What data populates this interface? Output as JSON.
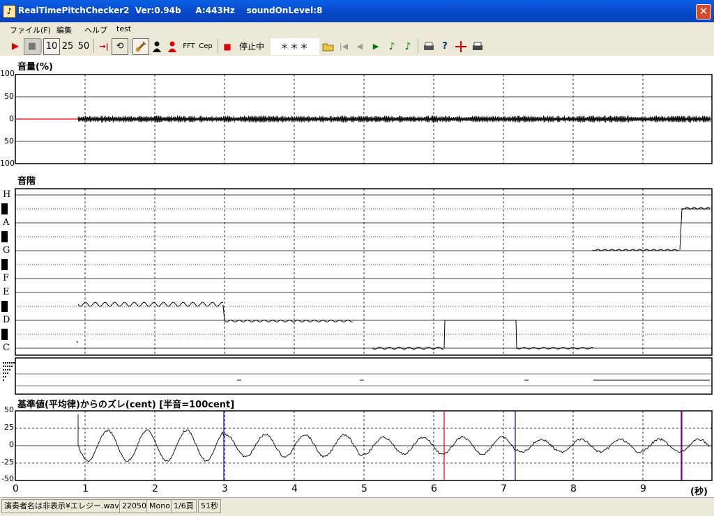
{
  "window": {
    "title": "RealTimePitchChecker2  Ver:0.94b     A:443Hz    soundOnLevel:8",
    "close_label": "✕",
    "app_icon": "note-icon"
  },
  "menu": [
    "ファイル(F)",
    "編集",
    "ヘルプ",
    "test"
  ],
  "toolbar": {
    "play": "▶",
    "stop": "■",
    "speed_labels": [
      "10",
      "25",
      "50"
    ],
    "jump": "→|",
    "loop": "⟲",
    "fft": "FFT",
    "cep": "Cep",
    "status_indicator": "■",
    "status_label": "停止中",
    "note_display": "＊＊＊",
    "icons": [
      "open-folder-icon",
      "skip-first-icon",
      "step-back-icon",
      "step-forward-icon",
      "note-green-icon",
      "note-green-outline-icon",
      "print-icon",
      "help-icon",
      "marker-icon",
      "printer-icon"
    ]
  },
  "volume_panel": {
    "title": "音量(%)",
    "y_labels": [
      "100",
      "50",
      "0",
      "50",
      "100"
    ]
  },
  "scale_panel": {
    "title": "音階",
    "note_labels": [
      "H",
      "A",
      "G",
      "F",
      "E",
      "D",
      "C"
    ]
  },
  "deviation_panel": {
    "title": "基準値(平均律)からのズレ(cent) [半音=100cent]",
    "y_labels": [
      "50",
      "25",
      "0",
      "-25",
      "-50"
    ]
  },
  "time_axis": {
    "ticks": [
      "0",
      "1",
      "2",
      "3",
      "4",
      "5",
      "6",
      "7",
      "8",
      "9"
    ],
    "unit": "(秒)"
  },
  "statusbar": {
    "file": "演奏者名は非表示¥エレジー.wav",
    "rate": "22050",
    "channels": "Mono",
    "page": "1/6頁",
    "duration": "51秒"
  }
}
